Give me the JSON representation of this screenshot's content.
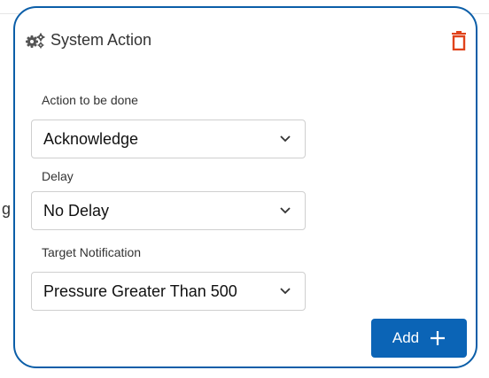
{
  "background": {
    "stray_text": "g"
  },
  "card": {
    "title": "System Action",
    "border_color": "#0b5ea8",
    "delete_icon_color": "#e0431b",
    "fields": [
      {
        "label": "Action to be done",
        "value": "Acknowledge"
      },
      {
        "label": "Delay",
        "value": "No Delay"
      },
      {
        "label": "Target Notification",
        "value": "Pressure Greater Than 500"
      }
    ],
    "add_button": {
      "label": "Add",
      "color": "#0b64b6"
    }
  }
}
